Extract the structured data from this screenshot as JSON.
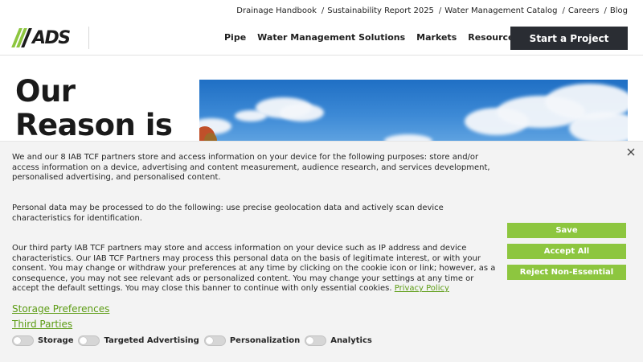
{
  "utility_nav": {
    "items": [
      {
        "label": "Drainage Handbook"
      },
      {
        "label": "Sustainability Report 2025"
      },
      {
        "label": "Water Management Catalog"
      },
      {
        "label": "Careers"
      },
      {
        "label": "Blog"
      }
    ],
    "separator": "/"
  },
  "header": {
    "logo_text": "ADS",
    "nav": [
      {
        "label": "Pipe"
      },
      {
        "label": "Water Management Solutions"
      },
      {
        "label": "Markets"
      },
      {
        "label": "Resources & Tools"
      }
    ],
    "cta_label": "Start a Project"
  },
  "hero": {
    "heading_line1": "Our",
    "heading_line2": "Reason is"
  },
  "cookie_banner": {
    "paragraph1": "We and our 8 IAB TCF partners store and access information on your device for the following purposes: store and/or access information on a device, advertising and content measurement, audience research, and services development, personalised advertising, and personalised content.",
    "paragraph2": "Personal data may be processed to do the following: use precise geolocation data and actively scan device characteristics for identification.",
    "paragraph3": "Our third party IAB TCF partners may store and access information on your device such as IP address and device characteristics. Our IAB TCF Partners may process this personal data on the basis of legitimate interest, or with your consent. You may change or withdraw your preferences at any time by clicking on the cookie icon or link; however, as a consequence, you may not see relevant ads or personalized content. You may change your settings at any time or accept the default settings. You may close this banner to continue with only essential cookies.",
    "privacy_link": "Privacy Policy",
    "storage_preferences_link": "Storage Preferences",
    "third_parties_link": "Third Parties",
    "toggles": [
      {
        "label": "Storage",
        "on": false
      },
      {
        "label": "Targeted Advertising",
        "on": false
      },
      {
        "label": "Personalization",
        "on": false
      },
      {
        "label": "Analytics",
        "on": false
      }
    ],
    "buttons": {
      "save": "Save",
      "accept_all": "Accept All",
      "reject": "Reject Non-Essential"
    }
  },
  "colors": {
    "brand_green": "#8dc63f",
    "cta_dark": "#2a2d33",
    "link_green": "#5c9c14",
    "banner_bg": "#f3f3f3"
  }
}
